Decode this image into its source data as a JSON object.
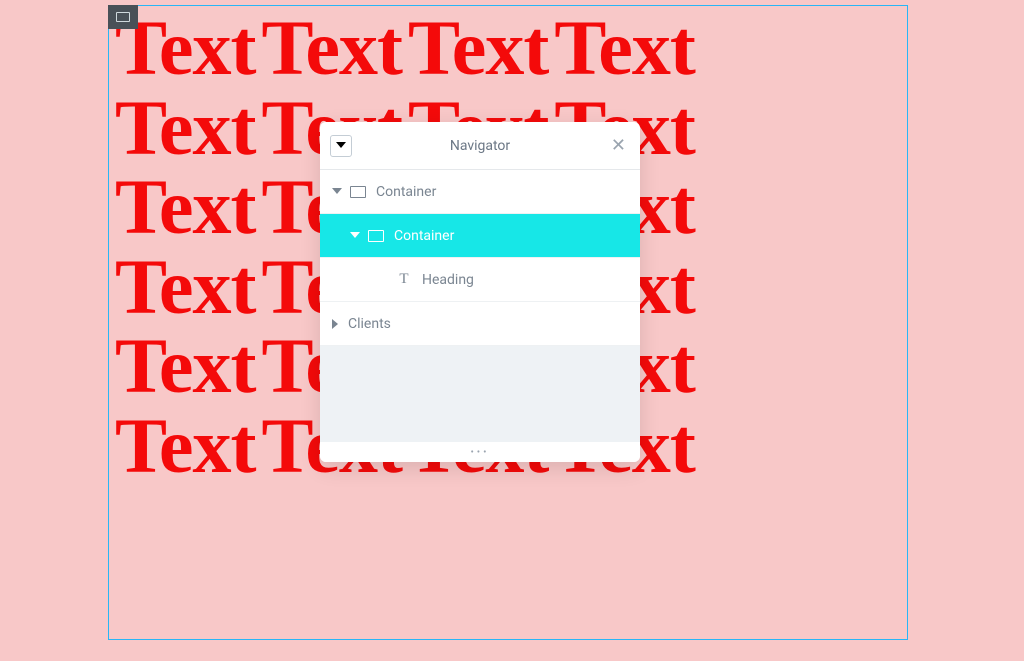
{
  "canvas": {
    "placeholder_word": "Text",
    "rows": 6,
    "cols": 4
  },
  "navigator": {
    "title": "Navigator",
    "tree": [
      {
        "label": "Container",
        "type": "container",
        "expanded": true,
        "depth": 0,
        "selected": false
      },
      {
        "label": "Container",
        "type": "container",
        "expanded": true,
        "depth": 1,
        "selected": true
      },
      {
        "label": "Heading",
        "type": "heading",
        "expanded": null,
        "depth": 2,
        "selected": false
      },
      {
        "label": "Clients",
        "type": "section",
        "expanded": false,
        "depth": 0,
        "selected": false
      }
    ]
  },
  "colors": {
    "selection_border": "#29b6f6",
    "handle_bg": "#495057",
    "accent_selected": "#17e7e7",
    "text_red": "#f40a0a",
    "page_bg": "#f8c8c8"
  }
}
